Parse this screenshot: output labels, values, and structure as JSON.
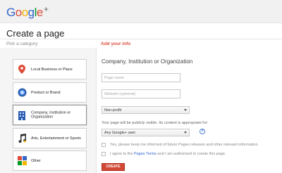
{
  "header": {
    "logo_text": "Google",
    "logo_plus": "+",
    "logo_colors": [
      "#3366cc",
      "#dd4b39",
      "#f4b400",
      "#3366cc",
      "#009925",
      "#dd4b39"
    ]
  },
  "page": {
    "title": "Create a page",
    "category_header": "Pick a category",
    "info_header": "Add your info"
  },
  "categories": [
    {
      "label": "Local Business or Place",
      "icon": "map-pin-icon",
      "selected": false
    },
    {
      "label": "Product or Brand",
      "icon": "tag-icon",
      "selected": false
    },
    {
      "label": "Company, Institution or Organization",
      "icon": "building-icon",
      "selected": true
    },
    {
      "label": "Arts, Entertainment or Sports",
      "icon": "music-note-icon",
      "selected": false
    },
    {
      "label": "Other",
      "icon": "grid-icon",
      "selected": false
    }
  ],
  "form": {
    "title": "Company, Institution or Organization",
    "page_name_placeholder": "Page name",
    "website_placeholder": "Website (optional)",
    "type_select": "Non-profit",
    "visibility_note": "Your page will be publicly visible. Its content is appropriate for:",
    "audience_select": "Any Google+ user",
    "help_icon": "?",
    "checkbox_updates": "Yes, please keep me informed of future Pages releases and other relevant information.",
    "terms_prefix": "I agree to the",
    "terms_link": "Pages Terms",
    "terms_suffix": "and I am authorized to create this page.",
    "create_button": "CREATE"
  },
  "colors": {
    "accent_red": "#dd4b39",
    "button_red": "#d14836",
    "link_blue": "#3366cc"
  }
}
